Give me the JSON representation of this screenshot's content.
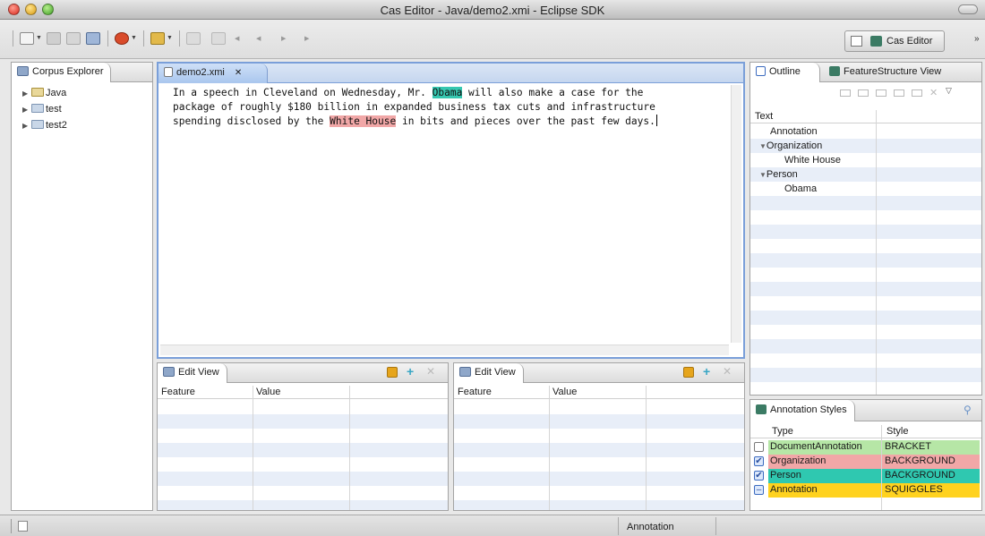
{
  "window": {
    "title": "Cas Editor - Java/demo2.xmi - Eclipse SDK"
  },
  "toolbar": {
    "perspective_label": "Cas Editor",
    "more": "»"
  },
  "corpus_explorer": {
    "title": "Corpus Explorer",
    "items": [
      {
        "label": "Java",
        "icon": "java-project-icon"
      },
      {
        "label": "test",
        "icon": "corpus-folder-icon"
      },
      {
        "label": "test2",
        "icon": "corpus-folder-icon"
      }
    ]
  },
  "editor": {
    "tab_title": "demo2.xmi",
    "close_glyph": "✕",
    "line1": {
      "a": "In a speech in Cleveland on Wednesday, Mr. ",
      "person": "Obama",
      "b": " will also make a case for the"
    },
    "line2": "package of roughly $180 billion in expanded business tax cuts and infrastructure",
    "line3": {
      "a": "spending disclosed by the ",
      "org": "White House",
      "b": " in bits and pieces over the past few days."
    }
  },
  "edit_views": [
    {
      "title": "Edit View",
      "col_feature": "Feature",
      "col_value": "Value"
    },
    {
      "title": "Edit View",
      "col_feature": "Feature",
      "col_value": "Value"
    }
  ],
  "outline": {
    "tab_outline": "Outline",
    "tab_feature_structure": "FeatureStructure View",
    "col_text": "Text",
    "rows": [
      {
        "label": "Annotation"
      },
      {
        "label": "Organization",
        "twisty": "▼"
      },
      {
        "label": "White House"
      },
      {
        "label": "Person",
        "twisty": "▼"
      },
      {
        "label": "Obama"
      }
    ]
  },
  "annotation_styles": {
    "title": "Annotation Styles",
    "col_type": "Type",
    "col_style": "Style",
    "rows": [
      {
        "type": "DocumentAnnotation",
        "style": "BRACKET",
        "check": "",
        "color": "#b6e6a6"
      },
      {
        "type": "Organization",
        "style": "BACKGROUND",
        "check": "✔",
        "color": "#f1a7a7"
      },
      {
        "type": "Person",
        "style": "BACKGROUND",
        "check": "✔",
        "color": "#2fc8b0"
      },
      {
        "type": "Annotation",
        "style": "SQUIGGLES",
        "check": "–",
        "color": "#ffd21f"
      }
    ]
  },
  "status": {
    "current_type": "Annotation"
  }
}
